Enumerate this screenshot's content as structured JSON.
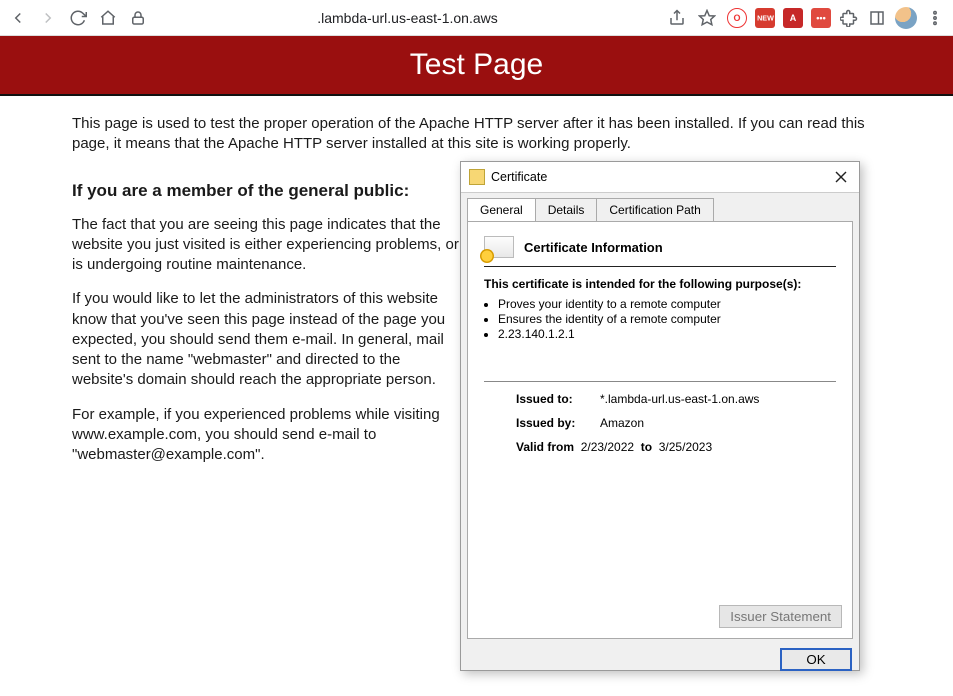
{
  "toolbar": {
    "url_display": ".lambda-url.us-east-1.on.aws",
    "ext_new_label": "NEW"
  },
  "page": {
    "banner_title": "Test Page",
    "intro": "This page is used to test the proper operation of the Apache HTTP server after it has been installed. If you can read this page, it means that the Apache HTTP server installed at this site is working properly.",
    "heading": "If you are a member of the general public:",
    "p1": "The fact that you are seeing this page indicates that the website you just visited is either experiencing problems, or is undergoing routine maintenance.",
    "p2": "If you would like to let the administrators of this website know that you've seen this page instead of the page you expected, you should send them e-mail. In general, mail sent to the name \"webmaster\" and directed to the website's domain should reach the appropriate person.",
    "p3": "For example, if you experienced problems while visiting www.example.com, you should send e-mail to \"webmaster@example.com\"."
  },
  "cert": {
    "window_title": "Certificate",
    "tabs": {
      "general": "General",
      "details": "Details",
      "path": "Certification Path"
    },
    "info_title": "Certificate Information",
    "purpose_heading": "This certificate is intended for the following purpose(s):",
    "purposes": [
      "Proves your identity to a remote computer",
      "Ensures the identity of a remote computer",
      "2.23.140.1.2.1"
    ],
    "issued_to_label": "Issued to:",
    "issued_to": "*.lambda-url.us-east-1.on.aws",
    "issued_by_label": "Issued by:",
    "issued_by": "Amazon",
    "valid_from_label": "Valid from",
    "valid_from": "2/23/2022",
    "valid_to_label": "to",
    "valid_to": "3/25/2023",
    "issuer_statement": "Issuer Statement",
    "ok": "OK"
  }
}
